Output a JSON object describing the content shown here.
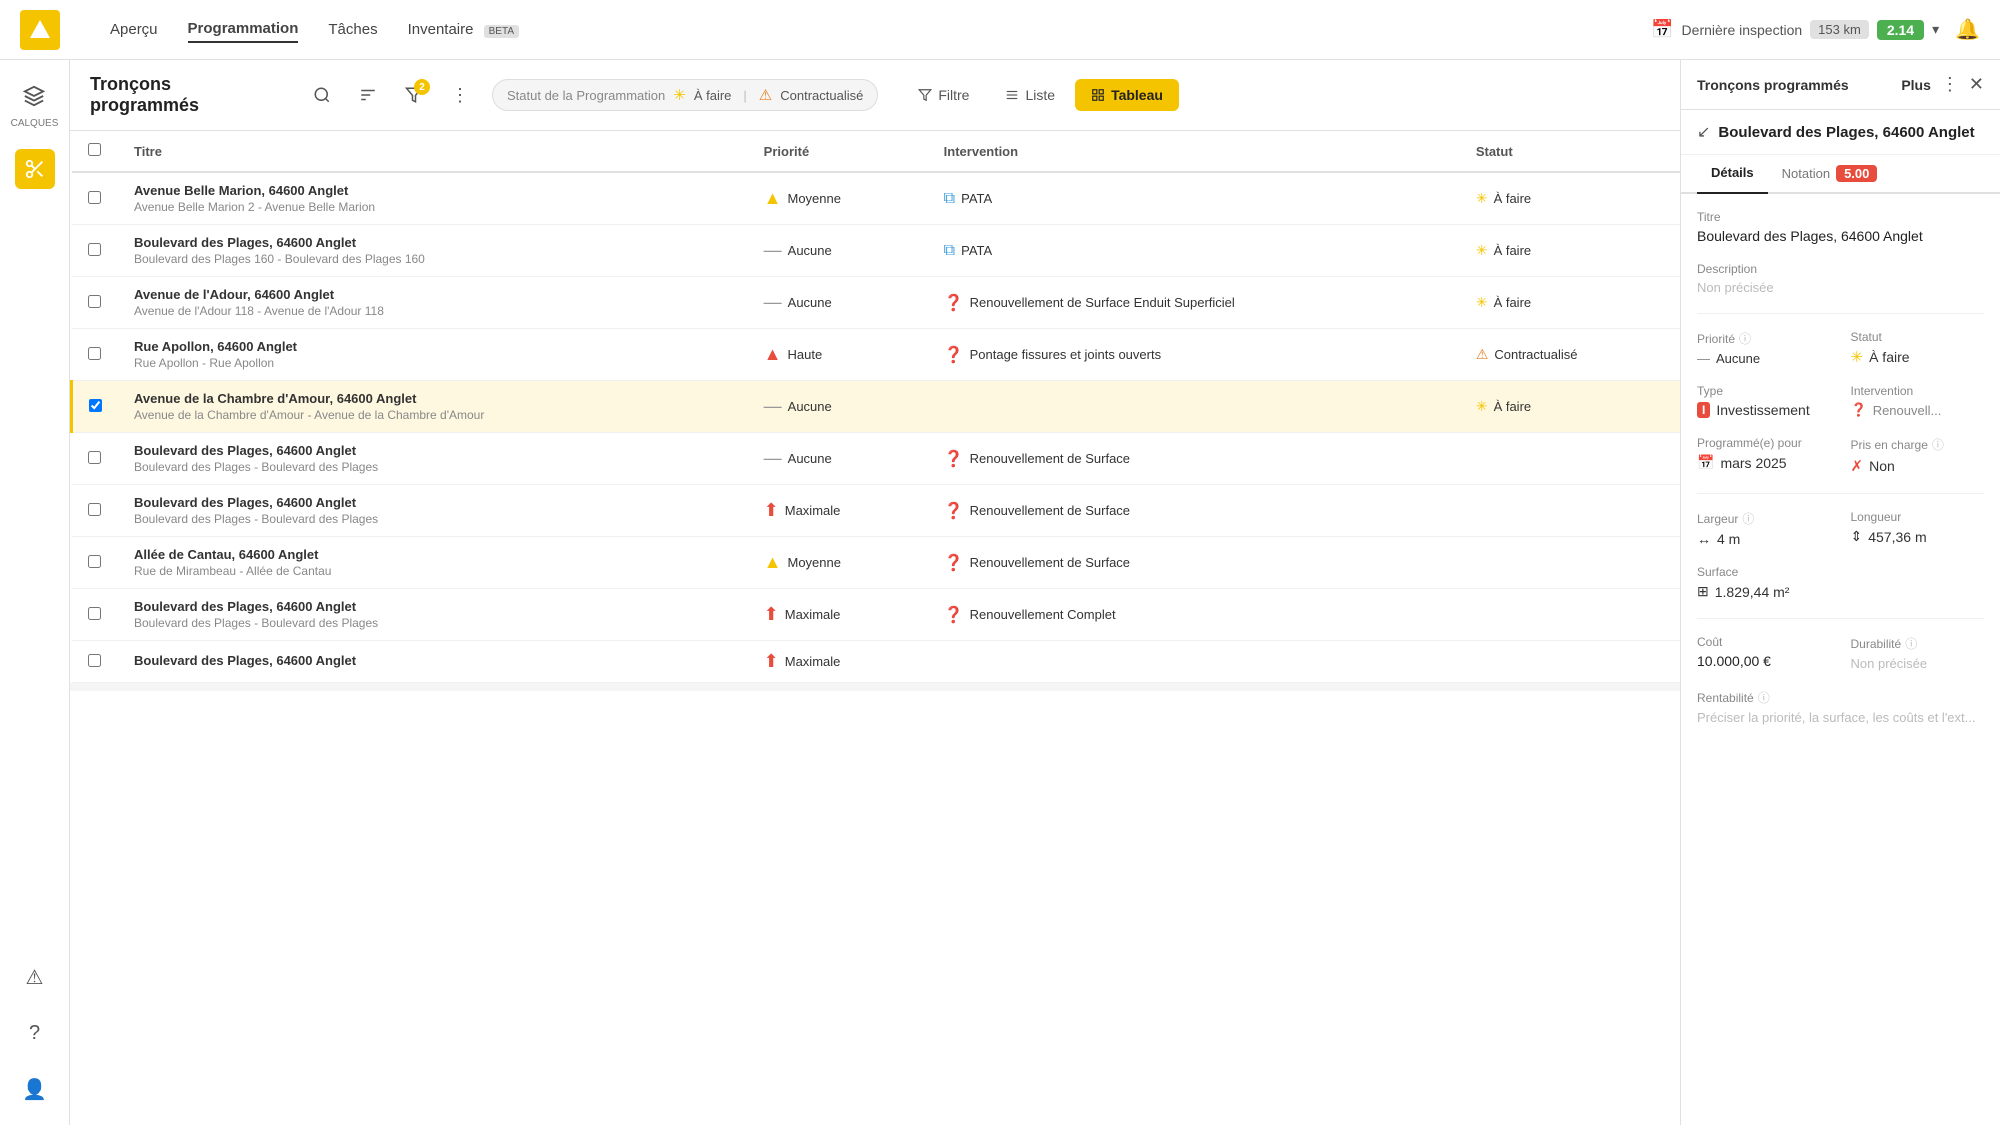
{
  "app": {
    "logo_alt": "Voilab logo"
  },
  "nav": {
    "items": [
      {
        "id": "apercu",
        "label": "Aperçu",
        "active": false
      },
      {
        "id": "programmation",
        "label": "Programmation",
        "active": true
      },
      {
        "id": "taches",
        "label": "Tâches",
        "active": false
      },
      {
        "id": "inventaire",
        "label": "Inventaire",
        "active": false
      }
    ],
    "inventaire_badge": "BETA",
    "last_inspection_label": "Dernière inspection",
    "distance": "153 km",
    "score": "2.14"
  },
  "sidebar": {
    "calques_label": "CALQUES",
    "icons": [
      "layers",
      "scissors",
      "warning"
    ]
  },
  "toolbar": {
    "title_line1": "Tronçons",
    "title_line2": "programmés",
    "filter_badge": "2",
    "filter_chip_label": "Statut de la Programmation",
    "chip1_label": "À faire",
    "chip2_label": "Contractualisé",
    "views": [
      {
        "id": "filtre",
        "label": "Filtre",
        "active": false
      },
      {
        "id": "liste",
        "label": "Liste",
        "active": false
      },
      {
        "id": "tableau",
        "label": "Tableau",
        "active": true
      }
    ]
  },
  "table": {
    "columns": [
      "Titre",
      "Priorité",
      "Intervention",
      "Statut"
    ],
    "rows": [
      {
        "id": 1,
        "title": "Avenue Belle Marion, 64600 Anglet",
        "subtitle": "Avenue Belle Marion 2 - Avenue Belle Marion",
        "priority": "Moyenne",
        "priority_type": "moyenne",
        "intervention": "PATA",
        "intervention_type": "pata",
        "statut": "À faire",
        "statut_type": "afaire",
        "selected": false
      },
      {
        "id": 2,
        "title": "Boulevard des Plages, 64600 Anglet",
        "subtitle": "Boulevard des Plages 160 - Boulevard des Plages 160",
        "priority": "Aucune",
        "priority_type": "none",
        "intervention": "PATA",
        "intervention_type": "pata",
        "statut": "À faire",
        "statut_type": "afaire",
        "selected": false
      },
      {
        "id": 3,
        "title": "Avenue de l'Adour, 64600 Anglet",
        "subtitle": "Avenue de l'Adour 118 - Avenue de l'Adour 118",
        "priority": "Aucune",
        "priority_type": "none",
        "intervention": "Renouvellement de Surface Enduit Superficiel",
        "intervention_type": "question",
        "statut": "À faire",
        "statut_type": "afaire",
        "selected": false
      },
      {
        "id": 4,
        "title": "Rue Apollon, 64600 Anglet",
        "subtitle": "Rue Apollon - Rue Apollon",
        "priority": "Haute",
        "priority_type": "haute",
        "intervention": "Pontage fissures et joints ouverts",
        "intervention_type": "question",
        "statut": "Contractualisé",
        "statut_type": "contractualise",
        "selected": false
      },
      {
        "id": 5,
        "title": "Avenue de la Chambre d'Amour, 64600 Anglet",
        "subtitle": "Avenue de la Chambre d'Amour - Avenue de la Chambre d'Amour",
        "priority": "Aucune",
        "priority_type": "none",
        "intervention": "",
        "intervention_type": "none",
        "statut": "À faire",
        "statut_type": "afaire",
        "selected": true
      },
      {
        "id": 6,
        "title": "Boulevard des Plages, 64600 Anglet",
        "subtitle": "Boulevard des Plages - Boulevard des Plages",
        "priority": "Aucune",
        "priority_type": "none",
        "intervention": "Renouvellement de Surface",
        "intervention_type": "question",
        "statut": "",
        "statut_type": "none",
        "selected": false
      },
      {
        "id": 7,
        "title": "Boulevard des Plages, 64600 Anglet",
        "subtitle": "Boulevard des Plages - Boulevard des Plages",
        "priority": "Maximale",
        "priority_type": "maximale",
        "intervention": "Renouvellement de Surface",
        "intervention_type": "question",
        "statut": "",
        "statut_type": "none",
        "selected": false
      },
      {
        "id": 8,
        "title": "Allée de Cantau, 64600 Anglet",
        "subtitle": "Rue de Mirambeau - Allée de Cantau",
        "priority": "Moyenne",
        "priority_type": "moyenne",
        "intervention": "Renouvellement de Surface",
        "intervention_type": "question",
        "statut": "",
        "statut_type": "none",
        "selected": false
      },
      {
        "id": 9,
        "title": "Boulevard des Plages, 64600 Anglet",
        "subtitle": "Boulevard des Plages - Boulevard des Plages",
        "priority": "Maximale",
        "priority_type": "maximale",
        "intervention": "Renouvellement Complet",
        "intervention_type": "question",
        "statut": "",
        "statut_type": "none",
        "selected": false
      },
      {
        "id": 10,
        "title": "Boulevard des Plages, 64600 Anglet",
        "subtitle": "",
        "priority": "Maximale",
        "priority_type": "maximale",
        "intervention": "",
        "intervention_type": "none",
        "statut": "",
        "statut_type": "none",
        "selected": false
      }
    ]
  },
  "right_panel": {
    "header_title": "Tronçons programmés",
    "plus_label": "Plus",
    "road_title": "Boulevard des Plages, 64600 Anglet",
    "tabs": [
      {
        "id": "details",
        "label": "Détails",
        "active": true
      },
      {
        "id": "notation",
        "label": "Notation",
        "active": false
      }
    ],
    "notation_score": "5.00",
    "fields": {
      "titre_label": "Titre",
      "titre_value": "Boulevard des Plages, 64600 Anglet",
      "description_label": "Description",
      "description_empty": "Non précisée",
      "priorite_label": "Priorité",
      "priorite_value": "Aucune",
      "statut_label": "Statut",
      "statut_value": "À faire",
      "type_label": "Type",
      "type_value": "Investissement",
      "type_letter": "I",
      "intervention_label": "Intervention",
      "intervention_value": "Renouvell...",
      "programme_label": "Programmé(e) pour",
      "programme_value": "mars 2025",
      "pris_en_charge_label": "Pris en charge",
      "pris_en_charge_value": "Non",
      "largeur_label": "Largeur",
      "largeur_value": "4 m",
      "longueur_label": "Longueur",
      "longueur_value": "457,36 m",
      "surface_label": "Surface",
      "surface_value": "1.829,44 m²",
      "cout_label": "Coût",
      "cout_value": "10.000,00 €",
      "durabilite_label": "Durabilité",
      "durabilite_empty": "Non précisée",
      "rentabilite_label": "Rentabilité",
      "rentabilite_empty": "Préciser la priorité, la surface, les coûts et l'ext..."
    }
  }
}
